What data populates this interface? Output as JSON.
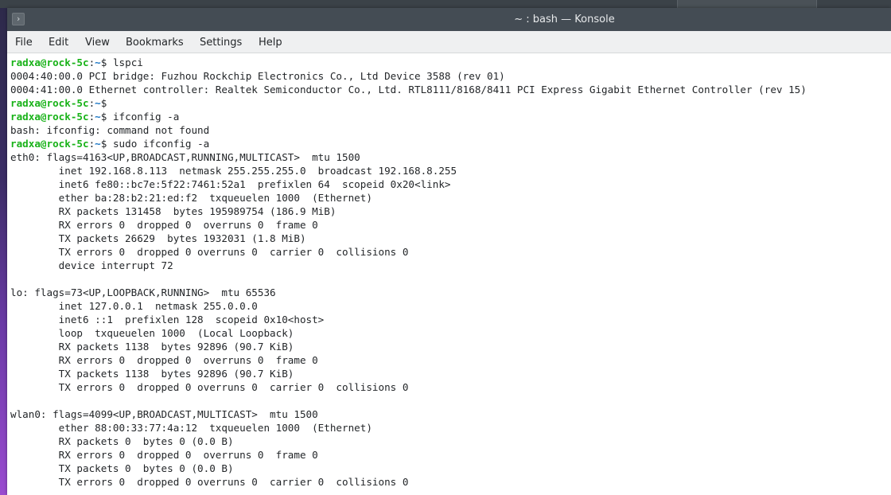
{
  "window": {
    "title": "~ : bash — Konsole",
    "app_icon": "terminal-icon",
    "app_icon_glyph": "›"
  },
  "menubar": {
    "items": [
      "File",
      "Edit",
      "View",
      "Bookmarks",
      "Settings",
      "Help"
    ]
  },
  "colors": {
    "titlebar_bg": "#444c54",
    "menubar_bg": "#eff0f1",
    "terminal_bg": "#ffffff",
    "terminal_fg": "#232629",
    "prompt_user": "#18b218",
    "prompt_path": "#1a76c4"
  },
  "prompt": {
    "user_host": "radxa@rock-5c",
    "separator": ":",
    "path": "~",
    "symbol": "$"
  },
  "terminal": {
    "lines": [
      {
        "prompt": true,
        "text": " lspci"
      },
      {
        "text": "0004:40:00.0 PCI bridge: Fuzhou Rockchip Electronics Co., Ltd Device 3588 (rev 01)"
      },
      {
        "text": "0004:41:00.0 Ethernet controller: Realtek Semiconductor Co., Ltd. RTL8111/8168/8411 PCI Express Gigabit Ethernet Controller (rev 15)"
      },
      {
        "prompt": true,
        "text": ""
      },
      {
        "prompt": true,
        "text": " ifconfig -a"
      },
      {
        "text": "bash: ifconfig: command not found"
      },
      {
        "prompt": true,
        "text": " sudo ifconfig -a"
      },
      {
        "text": "eth0: flags=4163<UP,BROADCAST,RUNNING,MULTICAST>  mtu 1500"
      },
      {
        "text": "        inet 192.168.8.113  netmask 255.255.255.0  broadcast 192.168.8.255"
      },
      {
        "text": "        inet6 fe80::bc7e:5f22:7461:52a1  prefixlen 64  scopeid 0x20<link>"
      },
      {
        "text": "        ether ba:28:b2:21:ed:f2  txqueuelen 1000  (Ethernet)"
      },
      {
        "text": "        RX packets 131458  bytes 195989754 (186.9 MiB)"
      },
      {
        "text": "        RX errors 0  dropped 0  overruns 0  frame 0"
      },
      {
        "text": "        TX packets 26629  bytes 1932031 (1.8 MiB)"
      },
      {
        "text": "        TX errors 0  dropped 0 overruns 0  carrier 0  collisions 0"
      },
      {
        "text": "        device interrupt 72"
      },
      {
        "text": ""
      },
      {
        "text": "lo: flags=73<UP,LOOPBACK,RUNNING>  mtu 65536"
      },
      {
        "text": "        inet 127.0.0.1  netmask 255.0.0.0"
      },
      {
        "text": "        inet6 ::1  prefixlen 128  scopeid 0x10<host>"
      },
      {
        "text": "        loop  txqueuelen 1000  (Local Loopback)"
      },
      {
        "text": "        RX packets 1138  bytes 92896 (90.7 KiB)"
      },
      {
        "text": "        RX errors 0  dropped 0  overruns 0  frame 0"
      },
      {
        "text": "        TX packets 1138  bytes 92896 (90.7 KiB)"
      },
      {
        "text": "        TX errors 0  dropped 0 overruns 0  carrier 0  collisions 0"
      },
      {
        "text": ""
      },
      {
        "text": "wlan0: flags=4099<UP,BROADCAST,MULTICAST>  mtu 1500"
      },
      {
        "text": "        ether 88:00:33:77:4a:12  txqueuelen 1000  (Ethernet)"
      },
      {
        "text": "        RX packets 0  bytes 0 (0.0 B)"
      },
      {
        "text": "        RX errors 0  dropped 0  overruns 0  frame 0"
      },
      {
        "text": "        TX packets 0  bytes 0 (0.0 B)"
      },
      {
        "text": "        TX errors 0  dropped 0 overruns 0  carrier 0  collisions 0"
      }
    ]
  }
}
